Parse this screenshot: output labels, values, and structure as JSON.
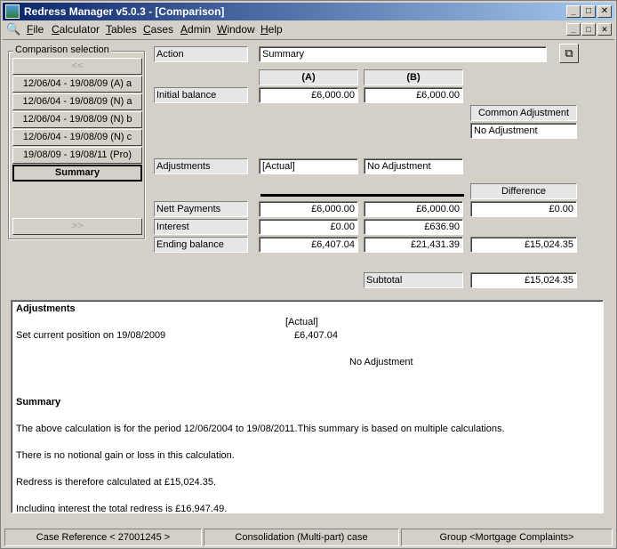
{
  "window": {
    "title": "Redress Manager v5.0.3 - [Comparison]",
    "minimize_glyph": "_",
    "maximize_glyph": "□",
    "close_glyph": "✕"
  },
  "menu": {
    "items": [
      "File",
      "Calculator",
      "Tables",
      "Cases",
      "Admin",
      "Window",
      "Help"
    ]
  },
  "selection": {
    "group_label": "Comparison selection",
    "prev_label": "<<",
    "next_label": ">>",
    "items": [
      "12/06/04 - 19/08/09 (A) a",
      "12/06/04 - 19/08/09 (N) a",
      "12/06/04 - 19/08/09 (N) b",
      "12/06/04 - 19/08/09 (N) c",
      "19/08/09 - 19/08/11 (Pro)",
      "Summary"
    ]
  },
  "form": {
    "action_label": "Action",
    "action_value": "Summary",
    "col_a": "(A)",
    "col_b": "(B)",
    "initial_balance_label": "Initial balance",
    "initial_a": "£6,000.00",
    "initial_b": "£6,000.00",
    "common_adjustment_label": "Common Adjustment",
    "common_adjustment_value": "No Adjustment",
    "adjustments_label": "Adjustments",
    "adj_a": "[Actual]",
    "adj_b": "No Adjustment",
    "difference_label": "Difference",
    "nett_label": "Nett Payments",
    "nett_a": "£6,000.00",
    "nett_b": "£6,000.00",
    "nett_diff": "£0.00",
    "interest_label": "Interest",
    "interest_a": "£0.00",
    "interest_b": "£636.90",
    "ending_label": "Ending balance",
    "ending_a": "£6,407.04",
    "ending_b": "£21,431.39",
    "ending_diff": "£15,024.35",
    "subtotal_label": "Subtotal",
    "subtotal_value": "£15,024.35"
  },
  "report": {
    "adjustments_heading": "Adjustments",
    "actual_label": "[Actual]",
    "set_position": "Set current position on 19/08/2009",
    "set_position_value": "£6,407.04",
    "no_adjustment": "No Adjustment",
    "summary_heading": "Summary",
    "line1": "The above calculation is for the period 12/06/2004 to 19/08/2011.This summary is based on multiple calculations.",
    "line2": "There is no notional gain or loss in this calculation.",
    "line3": "Redress is therefore calculated at £15,024.35.",
    "line4": "Including interest the total redress is £16,947.49."
  },
  "status": {
    "case_ref": "Case Reference < 27001245 >",
    "consolidation": "Consolidation (Multi-part) case",
    "group": "Group <Mortgage Complaints>"
  }
}
